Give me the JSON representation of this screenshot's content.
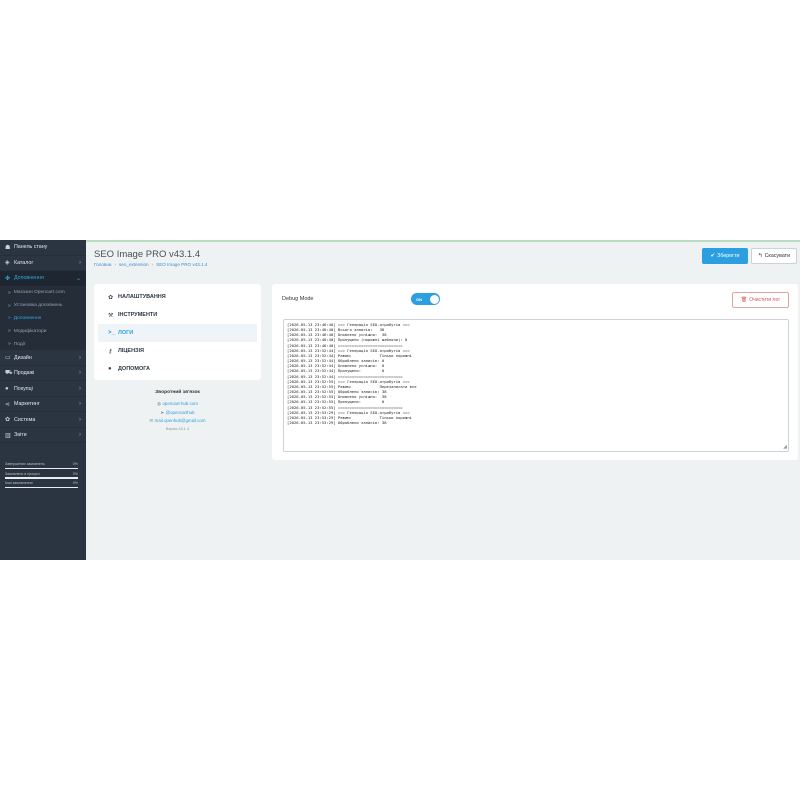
{
  "sidebar": {
    "items": [
      {
        "label": "Панель стану",
        "icon": "dashboard-icon",
        "glyph": "☗",
        "caret": ""
      },
      {
        "label": "Каталог",
        "icon": "tag-icon",
        "glyph": "◈",
        "caret": "›"
      },
      {
        "label": "Доповнення",
        "icon": "puzzle-icon",
        "glyph": "✤",
        "caret": "⌄",
        "active": true
      },
      {
        "label": "Дизайн",
        "icon": "monitor-icon",
        "glyph": "▭",
        "caret": "›"
      },
      {
        "label": "Продажі",
        "icon": "cart-icon",
        "glyph": "⛟",
        "caret": "›"
      },
      {
        "label": "Покупці",
        "icon": "user-icon",
        "glyph": "●",
        "caret": "›"
      },
      {
        "label": "Маркетинг",
        "icon": "share-icon",
        "glyph": "⋖",
        "caret": "›"
      },
      {
        "label": "Система",
        "icon": "gear-icon",
        "glyph": "✿",
        "caret": "›"
      },
      {
        "label": "Звіти",
        "icon": "bar-chart-icon",
        "glyph": "▥",
        "caret": "›"
      }
    ],
    "sub_items": [
      "Магазин Opencart.com",
      "Установка доповнень",
      "Доповнення",
      "Модифікатори",
      "Події"
    ],
    "stats": [
      {
        "label": "Завершених замовлень",
        "value": "0%"
      },
      {
        "label": "Замовлень в процесі",
        "value": "0%"
      },
      {
        "label": "Інші замовлення",
        "value": "0%"
      }
    ]
  },
  "header": {
    "title": "SEO Image PRO v43.1.4",
    "breadcrumb": [
      "Головна",
      "seo_extension",
      "SEO Image PRO v43.1.4"
    ],
    "save_label": "Зберегти",
    "cancel_label": "Скасувати"
  },
  "tabs": [
    {
      "label": "НАЛАШТУВАННЯ",
      "icon": "gear-icon",
      "glyph": "✿"
    },
    {
      "label": "ІНСТРУМЕНТИ",
      "icon": "wrench-icon",
      "glyph": "⚒"
    },
    {
      "label": "ЛОГИ",
      "icon": "terminal-icon",
      "glyph": ">_",
      "active": true
    },
    {
      "label": "ЛІЦЕНЗІЯ",
      "icon": "key-icon",
      "glyph": "⚷"
    },
    {
      "label": "ДОПОМОГА",
      "icon": "info-icon",
      "glyph": "●"
    }
  ],
  "feedback": {
    "title": "Зворотний зв'язок",
    "links": [
      "opencart-hub.com",
      "@opencarthub",
      "mail.openhub@gmail.com"
    ],
    "version": "Версія 43.1.4"
  },
  "logs": {
    "debug_label": "Debug Mode",
    "toggle_text": "ON",
    "clear_label": "Очистити лог",
    "lines": [
      "[2026-05-13 23:46:40] === Генерація SEO-атрибутів ===",
      "[2026-05-13 23:46:40] Всього записів:   38",
      "[2026-05-13 23:46:40] Оновлено успішно:  38",
      "[2026-05-13 23:46:40] Пропущено (порожні шаблони): 0",
      "[2026-05-13 23:46:40] ============================",
      "[2026-05-13 23:52:44] === Генерація SEO-атрибутів ===",
      "[2026-05-13 23:52:44] Режим:            Тільки порожні",
      "[2026-05-13 23:52:44] Оброблено записів: 0",
      "[2026-05-13 23:52:44] Оновлено успішно:  0",
      "[2026-05-13 23:52:44] Пропущено:         0",
      "[2026-05-13 23:52:44] ============================",
      "[2026-05-13 23:52:55] === Генерація SEO-атрибутів ===",
      "[2026-05-13 23:52:55] Режим:            Перезаписати все",
      "[2026-05-13 23:52:55] Оброблено записів: 38",
      "[2026-05-13 23:52:55] Оновлено успішно:  38",
      "[2026-05-13 23:52:55] Пропущено:         0",
      "[2026-05-13 23:52:55] ============================",
      "[2026-05-13 23:53:29] === Генерація SEO-атрибутів ===",
      "[2026-05-13 23:53:29] Режим:            Тільки порожні",
      "[2026-05-13 23:53:29] Оброблено записів: 38"
    ]
  }
}
